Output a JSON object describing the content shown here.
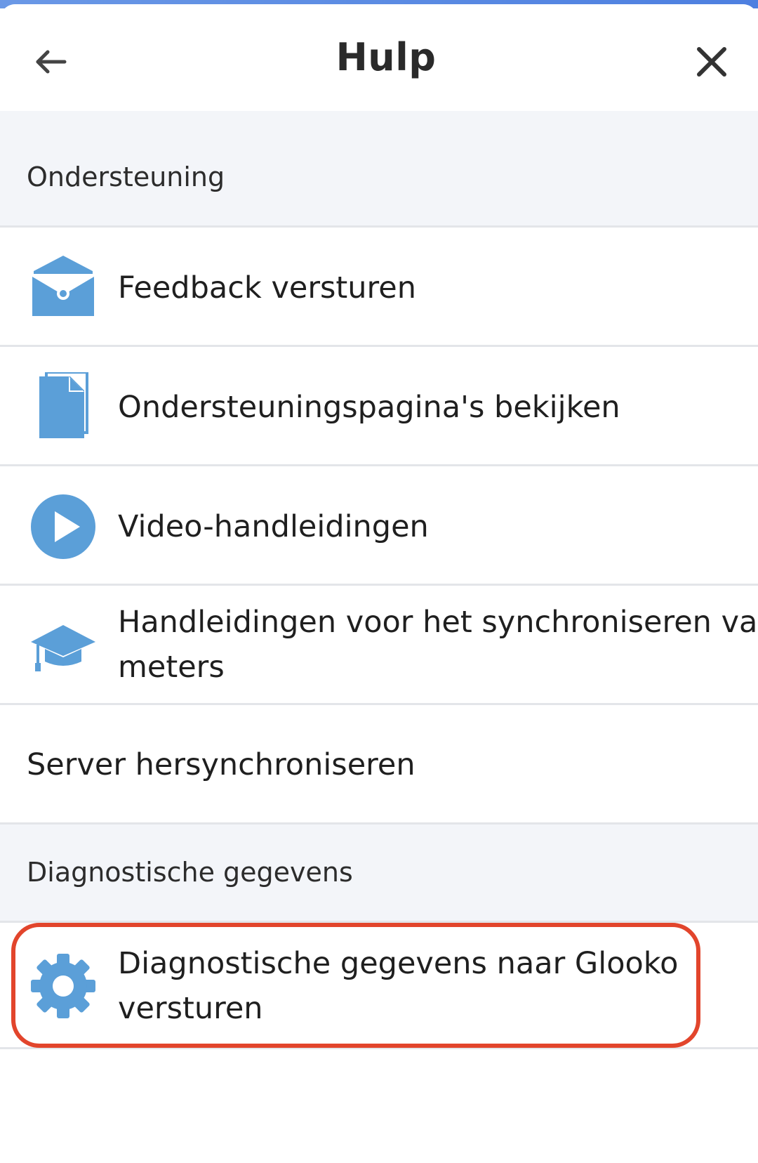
{
  "header": {
    "title": "Hulp",
    "back_icon": "arrow-left-icon",
    "close_icon": "close-icon"
  },
  "sections": {
    "support": {
      "label": "Ondersteuning"
    },
    "diagnostics": {
      "label": "Diagnostische gegevens"
    }
  },
  "items": {
    "feedback": {
      "label": "Feedback versturen",
      "icon": "envelope-icon"
    },
    "support_pages": {
      "label": "Ondersteuningspagina's bekijken",
      "icon": "document-icon"
    },
    "video_guides": {
      "label": "Video-handleidingen",
      "icon": "play-icon"
    },
    "meter_sync_guides": {
      "label_line1": "Handleidingen voor het synchroniseren van",
      "label_line2": "meters",
      "icon": "graduation-cap-icon"
    },
    "server_resync": {
      "label": "Server hersynchroniseren"
    },
    "send_diagnostics": {
      "label_line1": "Diagnostische gegevens naar Glooko",
      "label_line2": "versturen",
      "icon": "gear-icon"
    }
  },
  "colors": {
    "icon_blue": "#5b9fd8",
    "highlight_red": "#e2452c",
    "section_bg": "#f3f5f9",
    "divider": "#e3e5e9"
  }
}
